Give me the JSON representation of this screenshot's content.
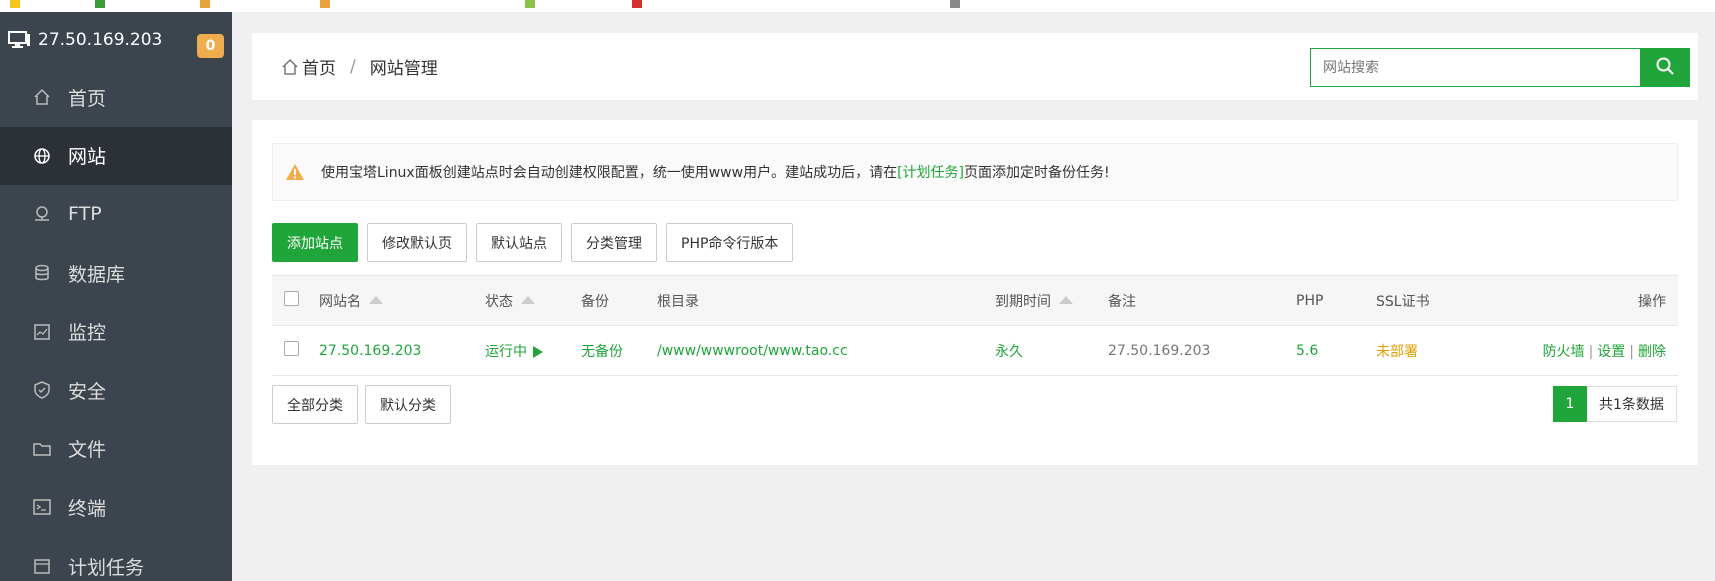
{
  "sidebar": {
    "server_ip": "27.50.169.203",
    "badge": "0",
    "items": [
      {
        "label": "首页",
        "icon": "home-icon"
      },
      {
        "label": "网站",
        "icon": "globe-icon"
      },
      {
        "label": "FTP",
        "icon": "ftp-icon"
      },
      {
        "label": "数据库",
        "icon": "database-icon"
      },
      {
        "label": "监控",
        "icon": "monitor-icon"
      },
      {
        "label": "安全",
        "icon": "shield-icon"
      },
      {
        "label": "文件",
        "icon": "folder-icon"
      },
      {
        "label": "终端",
        "icon": "terminal-icon"
      },
      {
        "label": "计划任务",
        "icon": "schedule-icon"
      }
    ],
    "active_index": 1
  },
  "header": {
    "breadcrumb_home": "首页",
    "breadcrumb_sep": "/",
    "breadcrumb_current": "网站管理",
    "search_placeholder": "网站搜索"
  },
  "notice": {
    "text_before": "使用宝塔Linux面板创建站点时会自动创建权限配置，统一使用www用户。建站成功后，请在",
    "link": "[计划任务]",
    "text_after": "页面添加定时备份任务!"
  },
  "toolbar": {
    "add_site": "添加站点",
    "modify_default_page": "修改默认页",
    "default_site": "默认站点",
    "category_manage": "分类管理",
    "php_cli_version": "PHP命令行版本"
  },
  "table": {
    "headers": {
      "site_name": "网站名",
      "status": "状态",
      "backup": "备份",
      "root": "根目录",
      "expire": "到期时间",
      "remark": "备注",
      "php": "PHP",
      "ssl": "SSL证书",
      "ops": "操作"
    },
    "rows": [
      {
        "site_name": "27.50.169.203",
        "status": "运行中",
        "backup": "无备份",
        "root": "/www/wwwroot/www.tao.cc",
        "expire": "永久",
        "remark": "27.50.169.203",
        "php": "5.6",
        "ssl": "未部署",
        "op_firewall": "防火墙",
        "op_settings": "设置",
        "op_delete": "删除",
        "op_sep": "|"
      }
    ]
  },
  "categories": {
    "all": "全部分类",
    "default": "默认分类"
  },
  "pager": {
    "current": "1",
    "total": "共1条数据"
  },
  "colors": {
    "accent": "#20a53a",
    "sidebar_bg": "#3c444d",
    "badge": "#f0ad4e",
    "ssl_warn": "#e0a000"
  }
}
